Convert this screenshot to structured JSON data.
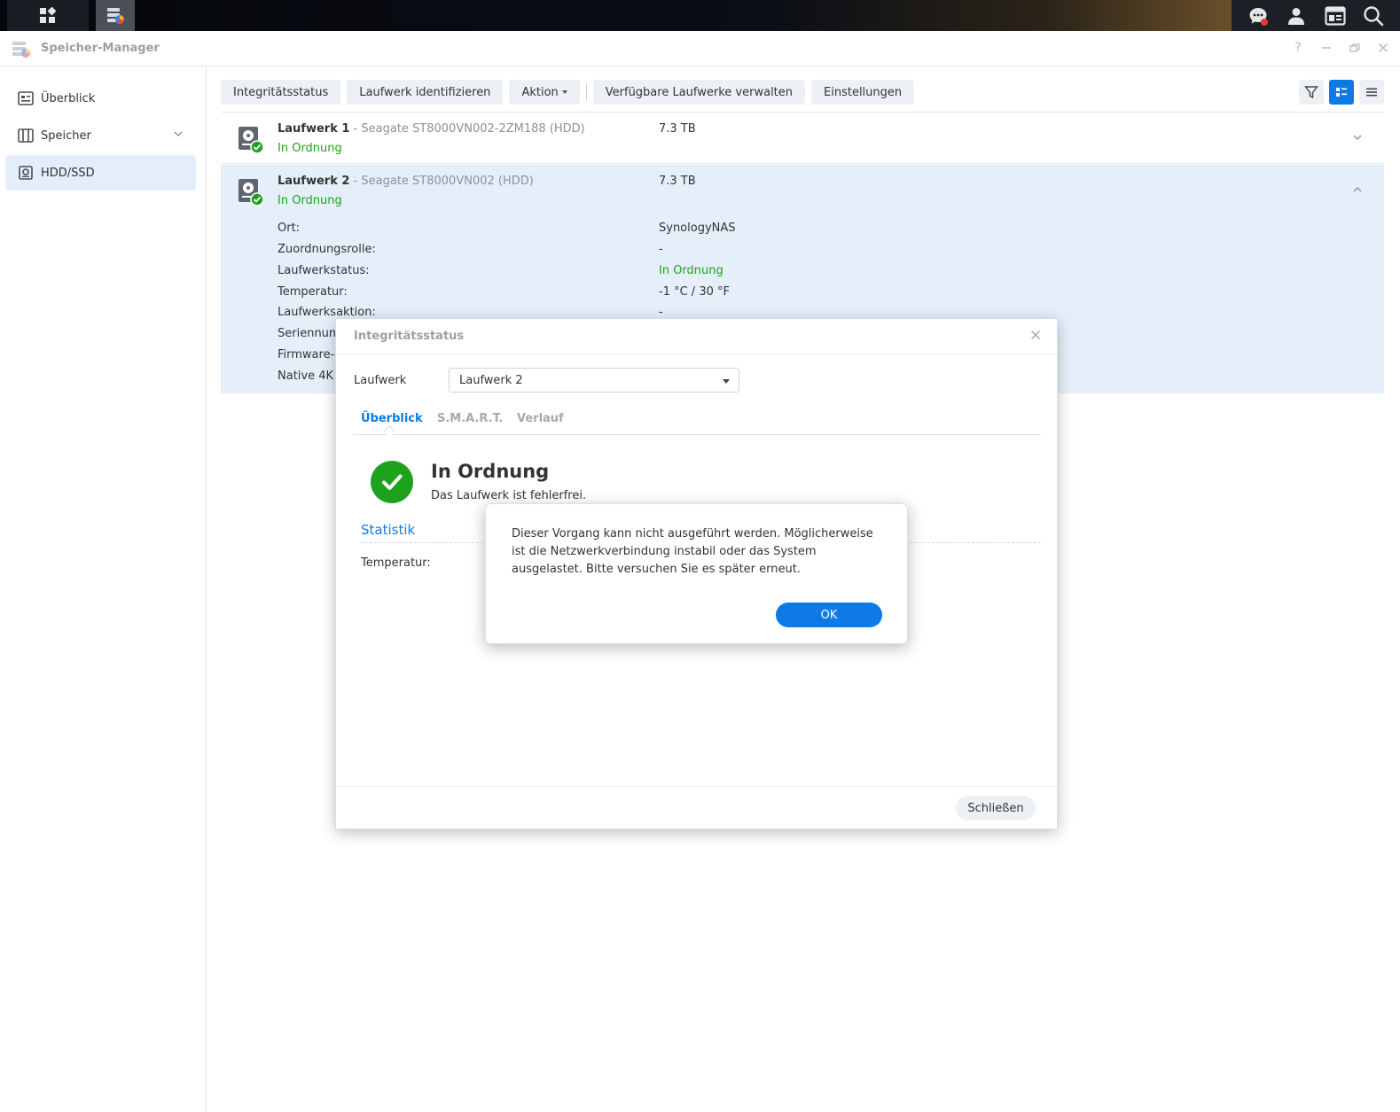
{
  "app": {
    "title": "Speicher-Manager"
  },
  "sidebar": {
    "items": [
      {
        "label": "Überblick"
      },
      {
        "label": "Speicher"
      },
      {
        "label": "HDD/SSD"
      }
    ]
  },
  "toolbar": {
    "health_label": "Integritätsstatus",
    "identify_label": "Laufwerk identifizieren",
    "action_label": "Aktion",
    "manage_label": "Verfügbare Laufwerke verwalten",
    "settings_label": "Einstellungen"
  },
  "drives": [
    {
      "name": "Laufwerk 1",
      "separator": " - ",
      "model": "Seagate ST8000VN002-2ZM188 (HDD)",
      "status": "In Ordnung",
      "size": "7.3 TB"
    },
    {
      "name": "Laufwerk 2",
      "separator": " - ",
      "model": "Seagate ST8000VN002 (HDD)",
      "status": "In Ordnung",
      "size": "7.3 TB",
      "details": [
        {
          "label": "Ort:",
          "value": "SynologyNAS"
        },
        {
          "label": "Zuordnungsrolle:",
          "value": "-"
        },
        {
          "label": "Laufwerkstatus:",
          "value": "In Ordnung"
        },
        {
          "label": "Temperatur:",
          "value": "-1 °C / 30 °F"
        },
        {
          "label": "Laufwerksaktion:",
          "value": "-"
        },
        {
          "label": "Seriennum",
          "value": ""
        },
        {
          "label": "Firmware-",
          "value": ""
        },
        {
          "label": "Native 4K",
          "value": ""
        }
      ]
    }
  ],
  "dialog": {
    "title": "Integritätsstatus",
    "drive_label": "Laufwerk",
    "drive_selected": "Laufwerk 2",
    "tabs": [
      {
        "label": "Überblick"
      },
      {
        "label": "S.M.A.R.T."
      },
      {
        "label": "Verlauf"
      }
    ],
    "status_title": "In Ordnung",
    "status_sub": "Das Laufwerk ist fehlerfrei.",
    "stat_title": "Statistik",
    "temp_label": "Temperatur:",
    "close_label": "Schließen"
  },
  "alert": {
    "message": "Dieser Vorgang kann nicht ausgeführt werden. Möglicherweise ist die Netzwerkverbindung instabil oder das System ausgelastet. Bitte versuchen Sie es später erneut.",
    "ok_label": "OK"
  },
  "colors": {
    "accent": "#0f7ae5",
    "ok_green": "#1ea21e",
    "selected_row": "#e5effa",
    "notification_dot": "#e53935"
  }
}
